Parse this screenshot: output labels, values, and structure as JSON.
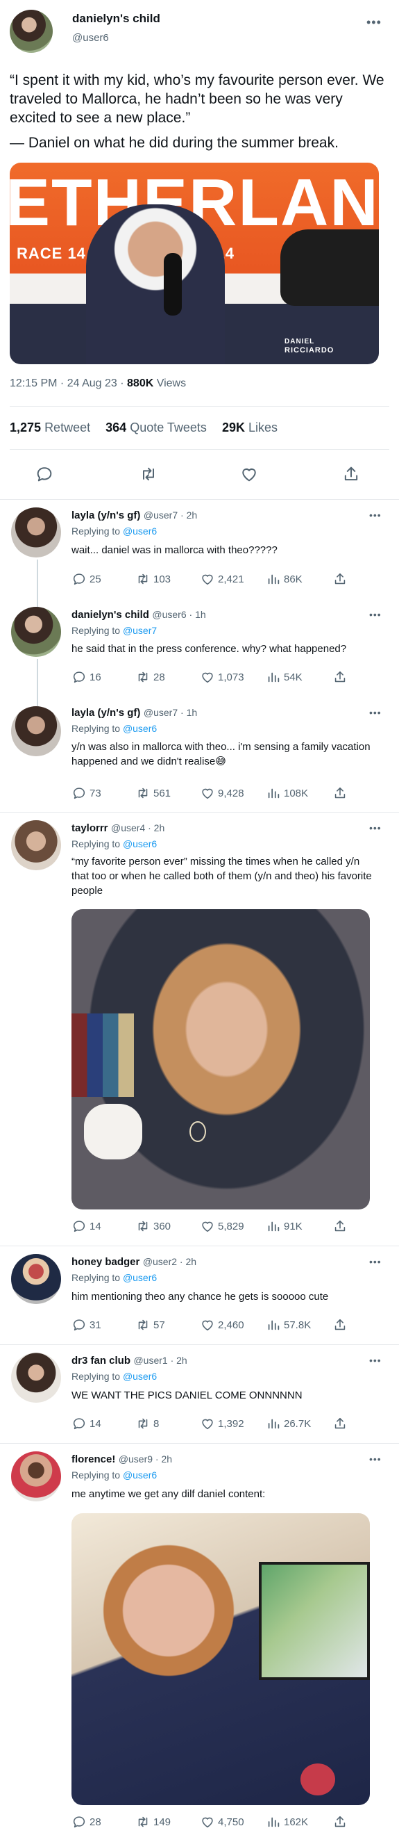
{
  "main_tweet": {
    "author_name": "danielyn's child",
    "author_handle": "@user6",
    "text_para1": "“I spent it with my kid, who’s my favourite person ever. We traveled to Mallorca, he hadn’t been so he was very excited to see a new place.”",
    "text_para2": "— Daniel on what he did during the summer break.",
    "image_text": "ETHERLANDS",
    "image_banner": "RACE 14  RACE 14  RACE 14",
    "image_caption_name": "DANIEL",
    "image_caption_surname": "RICCIARDO",
    "time": "12:15 PM · 24 Aug 23",
    "views_count": "880K",
    "views_label": "Views",
    "retweets_count": "1,275",
    "retweets_label": "Retweet",
    "quotes_count": "364",
    "quotes_label": "Quote Tweets",
    "likes_count": "29K",
    "likes_label": "Likes"
  },
  "icons": {
    "reply": "reply-icon",
    "retweet": "retweet-icon",
    "like": "heart-icon",
    "views": "views-icon",
    "share": "share-icon",
    "more": "more-icon"
  },
  "replies": [
    {
      "name": "layla (y/n's gf)",
      "handle": "@user7 · 2h",
      "replying_prefix": "Replying to",
      "replying_to": "@user6",
      "text": "wait... daniel was in mallorca with theo?????",
      "replies": "25",
      "retweets": "103",
      "likes": "2,421",
      "views": "86K"
    },
    {
      "name": "danielyn's child",
      "handle": "@user6 · 1h",
      "replying_prefix": "Replying to",
      "replying_to": "@user7",
      "text": "he said that in the press conference. why? what happened?",
      "replies": "16",
      "retweets": "28",
      "likes": "1,073",
      "views": "54K"
    },
    {
      "name": "layla (y/n's gf)",
      "handle": "@user7 · 1h",
      "replying_prefix": "Replying to",
      "replying_to": "@user6",
      "text": "y/n was also in mallorca with theo... i'm sensing a family vacation happened and we didn't realise😅",
      "replies": "73",
      "retweets": "561",
      "likes": "9,428",
      "views": "108K"
    },
    {
      "name": "taylorrr",
      "handle": "@user4 · 2h",
      "replying_prefix": "Replying to",
      "replying_to": "@user6",
      "text": "“my favorite person ever” missing the times when he called y/n that too or when he called both of them (y/n and theo) his favorite people",
      "replies": "14",
      "retweets": "360",
      "likes": "5,829",
      "views": "91K"
    },
    {
      "name": "honey badger",
      "handle": "@user2 · 2h",
      "replying_prefix": "Replying to",
      "replying_to": "@user6",
      "text": "him mentioning theo any chance he gets is sooooo cute",
      "replies": "31",
      "retweets": "57",
      "likes": "2,460",
      "views": "57.8K"
    },
    {
      "name": "dr3 fan club",
      "handle": "@user1 · 2h",
      "replying_prefix": "Replying to",
      "replying_to": "@user6",
      "text": "WE WANT THE PICS DANIEL COME ONNNNNN",
      "replies": "14",
      "retweets": "8",
      "likes": "1,392",
      "views": "26.7K"
    },
    {
      "name": "florence!",
      "handle": "@user9 · 2h",
      "replying_prefix": "Replying to",
      "replying_to": "@user6",
      "text": "me anytime we get any dilf daniel content:",
      "replies": "28",
      "retweets": "149",
      "likes": "4,750",
      "views": "162K"
    }
  ]
}
